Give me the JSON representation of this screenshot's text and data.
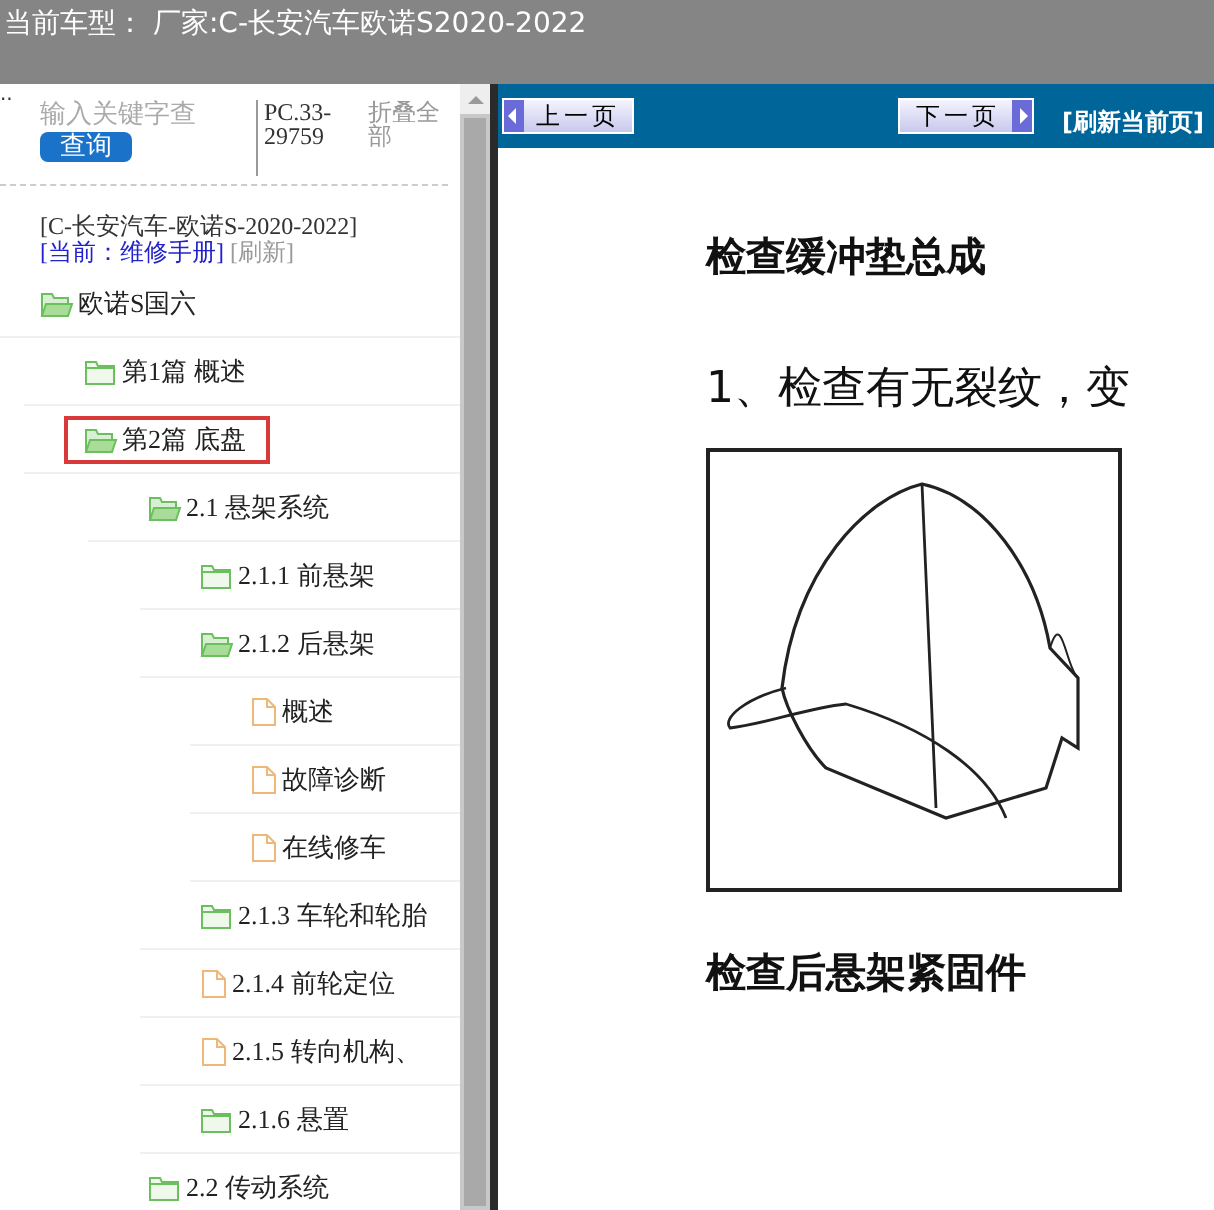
{
  "header": {
    "title": "当前车型： 厂家:C-长安汽车欧诺S2020-2022"
  },
  "side_panel": {
    "dots": "..",
    "search": {
      "placeholder": "输入关键字查",
      "button": "查询"
    },
    "code": "PC.33-29759",
    "collapse_all": "折叠全部",
    "model": "[C-长安汽车-欧诺S-2020-2022]",
    "current": "[当前：维修手册]",
    "refresh": "[刷新]",
    "tree": [
      {
        "kind": "folder",
        "label": "欧诺S国六",
        "expanded": true,
        "selected": false,
        "children": [
          {
            "kind": "folder",
            "label": "第1篇 概述",
            "expanded": false,
            "selected": false
          },
          {
            "kind": "folder",
            "label": "第2篇 底盘",
            "expanded": true,
            "selected": true,
            "children": [
              {
                "kind": "folder",
                "label": "2.1 悬架系统",
                "expanded": true,
                "selected": false,
                "children": [
                  {
                    "kind": "folder",
                    "label": "2.1.1 前悬架",
                    "expanded": false,
                    "selected": false
                  },
                  {
                    "kind": "folder",
                    "label": "2.1.2 后悬架",
                    "expanded": true,
                    "selected": false,
                    "children": [
                      {
                        "kind": "doc",
                        "label": "概述",
                        "selected": false
                      },
                      {
                        "kind": "doc",
                        "label": "故障诊断",
                        "selected": false
                      },
                      {
                        "kind": "doc",
                        "label": "在线修车",
                        "selected": false
                      }
                    ]
                  },
                  {
                    "kind": "folder",
                    "label": "2.1.3 车轮和轮胎",
                    "expanded": false,
                    "selected": false
                  },
                  {
                    "kind": "doc",
                    "label": "2.1.4 前轮定位",
                    "selected": false
                  },
                  {
                    "kind": "doc",
                    "label": "2.1.5 转向机构、",
                    "selected": false
                  },
                  {
                    "kind": "folder",
                    "label": "2.1.6 悬置",
                    "expanded": false,
                    "selected": false
                  }
                ]
              },
              {
                "kind": "folder",
                "label": "2.2 传动系统",
                "expanded": false,
                "selected": false
              }
            ]
          }
        ]
      }
    ]
  },
  "doc": {
    "prev": "上一页",
    "next": "下一页",
    "refresh": "[刷新当前页]",
    "heading": "检查缓冲垫总成",
    "step": "1、检查有无裂纹，变",
    "heading_2": "检查后悬架紧固件"
  }
}
